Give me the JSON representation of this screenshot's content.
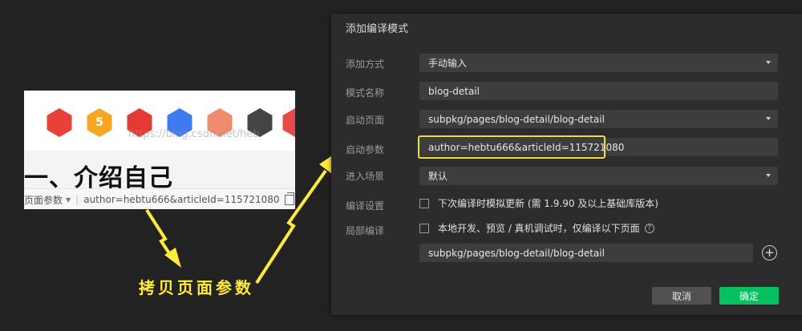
{
  "preview": {
    "heading": "一、介绍自己",
    "watermark": "https://blog.csdn.net/heb",
    "bar_label": "页面参数",
    "bar_value": "author=hebtu666&articleId=115721080",
    "badges": [
      {
        "icon": "monkey-icon",
        "color": "#e8413a",
        "text": ""
      },
      {
        "icon": "stripe-badge-icon",
        "color": "#f5a623",
        "text": "5"
      },
      {
        "icon": "crown-badge-icon",
        "color": "#e53935",
        "text": ""
      },
      {
        "icon": "fish-badge-icon",
        "color": "#3e7bf0",
        "text": ""
      },
      {
        "icon": "face-badge-icon",
        "color": "#f08c6e",
        "text": ""
      },
      {
        "icon": "chess-badge-icon",
        "color": "#444444",
        "text": ""
      },
      {
        "icon": "calendar-badge-icon",
        "color": "#e84a4a",
        "text": ""
      }
    ]
  },
  "annotation": {
    "text": "拷贝页面参数",
    "color": "#ffeb3b"
  },
  "dialog": {
    "title": "添加编译模式",
    "add_method": {
      "label": "添加方式",
      "value": "手动输入"
    },
    "mode_name": {
      "label": "模式名称",
      "value": "blog-detail"
    },
    "start_page": {
      "label": "启动页面",
      "value": "subpkg/pages/blog-detail/blog-detail"
    },
    "start_params": {
      "label": "启动参数",
      "value": "author=hebtu666&articleId=115721080"
    },
    "scene": {
      "label": "进入场景",
      "value": "默认"
    },
    "compile_settings": {
      "label": "编译设置",
      "option": "下次编译时模拟更新 (需 1.9.90 及以上基础库版本)"
    },
    "partial_compile": {
      "label": "局部编译",
      "option": "本地开发、预览 / 真机调试时，仅编译以下页面",
      "page": "subpkg/pages/blog-detail/blog-detail"
    },
    "cancel_label": "取消",
    "confirm_label": "确定",
    "accent_color": "#07c160",
    "highlight_color": "#f2e02c"
  }
}
